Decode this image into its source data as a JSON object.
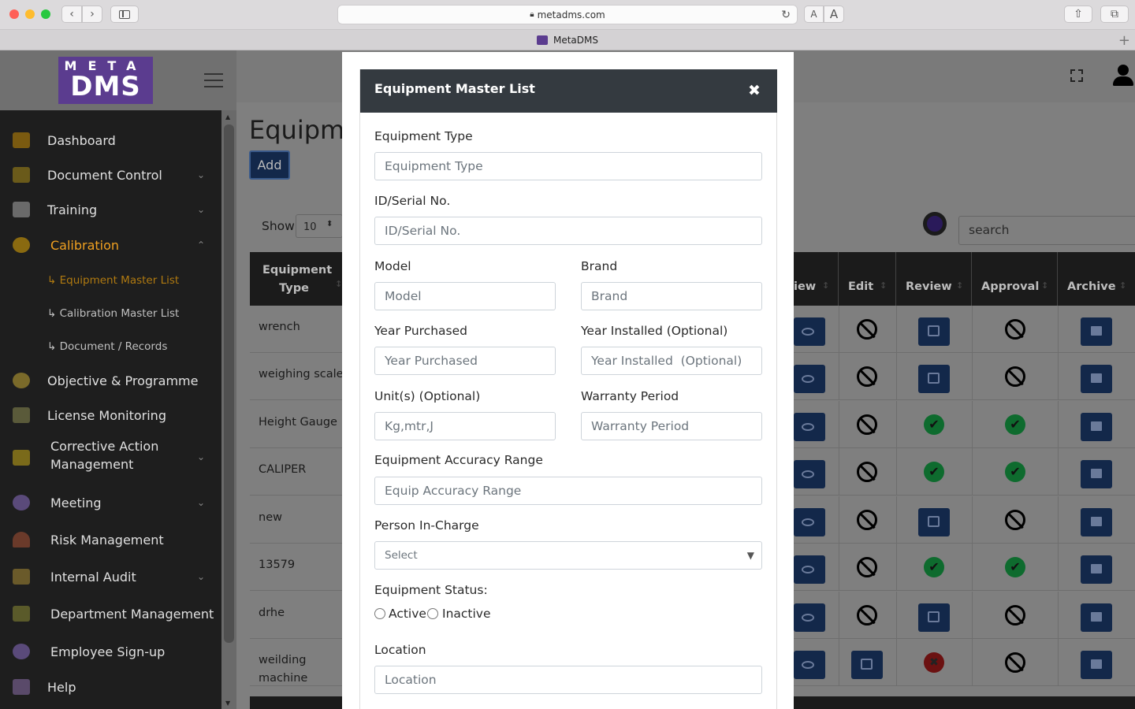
{
  "browser": {
    "url": "metadms.com",
    "tab_title": "MetaDMS",
    "font_small": "A",
    "font_large": "A"
  },
  "logo": {
    "line1": "META",
    "line2": "DMS"
  },
  "sidebar": {
    "items": [
      {
        "label": "Dashboard",
        "color": "#e0e0e0"
      },
      {
        "label": "Document Control",
        "color": "#e0e0e0"
      },
      {
        "label": "Training",
        "color": "#e0e0e0"
      },
      {
        "label": "Calibration",
        "color": "#f0a020"
      },
      {
        "label": "Objective & Programme",
        "color": "#e0e0e0"
      },
      {
        "label": "License Monitoring",
        "color": "#e0e0e0"
      },
      {
        "label": "Corrective Action",
        "color": "#e0e0e0"
      },
      {
        "label": "Management",
        "color": "#e0e0e0"
      },
      {
        "label": "Meeting",
        "color": "#e0e0e0"
      },
      {
        "label": "Risk Management",
        "color": "#e0e0e0"
      },
      {
        "label": "Internal Audit",
        "color": "#e0e0e0"
      },
      {
        "label": "Department Management",
        "color": "#e0e0e0"
      },
      {
        "label": "Employee Sign-up",
        "color": "#e0e0e0"
      },
      {
        "label": "Help",
        "color": "#e0e0e0"
      }
    ],
    "submenu": [
      "↳ Equipment Master List",
      "↳ Calibration Master List",
      "↳ Document / Records"
    ]
  },
  "page": {
    "title": "Equipme",
    "add_label": "Add",
    "show_label": "Show",
    "show_value": "10",
    "search_placeholder": "search"
  },
  "table": {
    "header_left": [
      "Equipment",
      "Type"
    ],
    "header_right": [
      "iew",
      "Edit",
      "Review",
      "Approval",
      "Archive"
    ],
    "rows": [
      {
        "type": "wrench",
        "type2": ""
      },
      {
        "type": "weighing scale",
        "type2": ""
      },
      {
        "type": "Height Gauge",
        "type2": ""
      },
      {
        "type": "CALIPER",
        "type2": ""
      },
      {
        "type": "new",
        "type2": ""
      },
      {
        "type": "13579",
        "type2": ""
      },
      {
        "type": "drhe",
        "type2": ""
      },
      {
        "type": "weilding",
        "type2": "machine"
      }
    ]
  },
  "modal": {
    "title": "Equipment Master List",
    "close": "✖",
    "fields": {
      "equipment_type": {
        "label": "Equipment Type",
        "placeholder": "Equipment Type"
      },
      "serial": {
        "label": "ID/Serial No.",
        "placeholder": "ID/Serial No."
      },
      "model": {
        "label": "Model",
        "placeholder": "Model"
      },
      "brand": {
        "label": "Brand",
        "placeholder": "Brand"
      },
      "year_purchased": {
        "label": "Year Purchased",
        "placeholder": "Year Purchased"
      },
      "year_installed": {
        "label": "Year Installed (Optional)",
        "placeholder": "Year Installed  (Optional)"
      },
      "units": {
        "label": "Unit(s) (Optional)",
        "placeholder": "Kg,mtr,J"
      },
      "warranty": {
        "label": "Warranty Period",
        "placeholder": "Warranty Period"
      },
      "accuracy": {
        "label": "Equipment Accuracy Range",
        "placeholder": "Equip Accuracy Range"
      },
      "person": {
        "label": "Person In-Charge",
        "value": "Select"
      },
      "status": {
        "label": "Equipment Status:",
        "active": "Active",
        "inactive": "Inactive"
      },
      "location": {
        "label": "Location",
        "placeholder": "Location"
      }
    }
  }
}
